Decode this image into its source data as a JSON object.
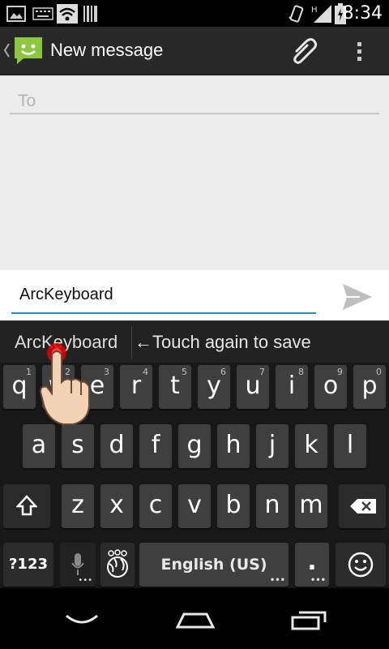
{
  "status": {
    "time": "8:34"
  },
  "actionbar": {
    "title": "New message"
  },
  "compose": {
    "to_placeholder": "To",
    "message_text": "ArcKeyboard"
  },
  "suggestion": {
    "word": "ArcKeyboard",
    "hint": "←Touch again to save"
  },
  "keyboard": {
    "row1": [
      {
        "label": "q",
        "hint": "1"
      },
      {
        "label": "w",
        "hint": "2"
      },
      {
        "label": "e",
        "hint": "3"
      },
      {
        "label": "r",
        "hint": "4"
      },
      {
        "label": "t",
        "hint": "5"
      },
      {
        "label": "y",
        "hint": "6"
      },
      {
        "label": "u",
        "hint": "7"
      },
      {
        "label": "i",
        "hint": "8"
      },
      {
        "label": "o",
        "hint": "9"
      },
      {
        "label": "p",
        "hint": "0"
      }
    ],
    "row2": [
      "a",
      "s",
      "d",
      "f",
      "g",
      "h",
      "j",
      "k",
      "l"
    ],
    "row3": [
      "z",
      "x",
      "c",
      "v",
      "b",
      "n",
      "m"
    ],
    "symbols_label": "?123",
    "space_label": "English (US)",
    "period_label": "."
  },
  "colors": {
    "accent": "#2e8fb0",
    "background": "#ececec",
    "keyboard_bg": "#181818",
    "key": "#3f3f3f"
  },
  "icons": [
    "image-icon",
    "keyboard-icon",
    "wifi-icon",
    "barcode-icon",
    "vibrate-icon",
    "signal-icon",
    "battery-icon",
    "messaging-app-icon",
    "attach-icon",
    "overflow-menu-icon",
    "send-icon",
    "shift-icon",
    "backspace-icon",
    "microphone-icon",
    "language-globe-icon",
    "emoji-icon",
    "back-nav-icon",
    "home-nav-icon",
    "recents-nav-icon",
    "hand-pointer-icon"
  ]
}
